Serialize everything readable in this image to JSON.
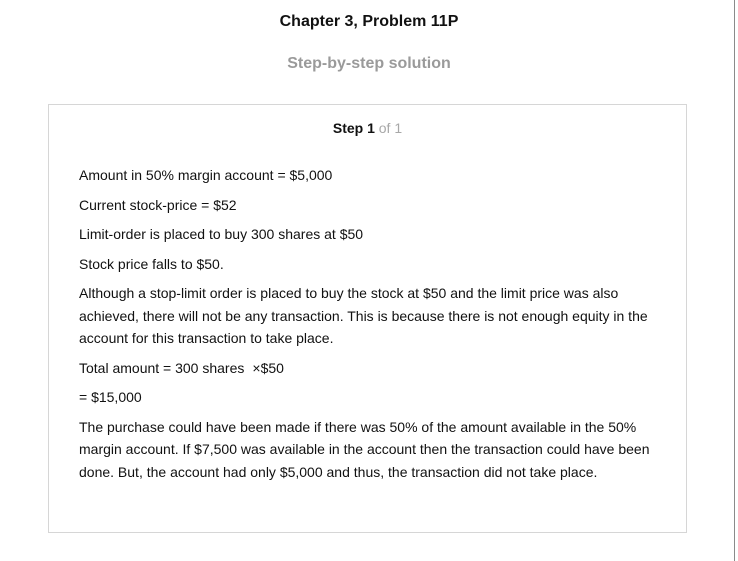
{
  "header": {
    "title": "Chapter 3, Problem 11P",
    "subtitle": "Step-by-step solution"
  },
  "step": {
    "label": "Step 1",
    "of": "of 1"
  },
  "solution": {
    "line1": "Amount in 50% margin account = $5,000",
    "line2": "Current stock-price = $52",
    "line3": "Limit-order is placed to buy 300 shares at $50",
    "line4": "Stock price falls to $50.",
    "paragraph1": "Although a stop-limit order is placed to buy the stock at $50 and the limit price was also achieved, there will not be any transaction. This is because there is not enough equity in the account for this transaction to take place.",
    "total_prefix": "Total amount = 300 shares",
    "total_operator": "×$50",
    "total_result": "= $15,000",
    "paragraph2": "The purchase could have been made if there was 50% of the amount available in the 50% margin account. If $7,500 was available in the account then the transaction could have been done. But, the account had only $5,000 and thus, the transaction did not take place."
  }
}
